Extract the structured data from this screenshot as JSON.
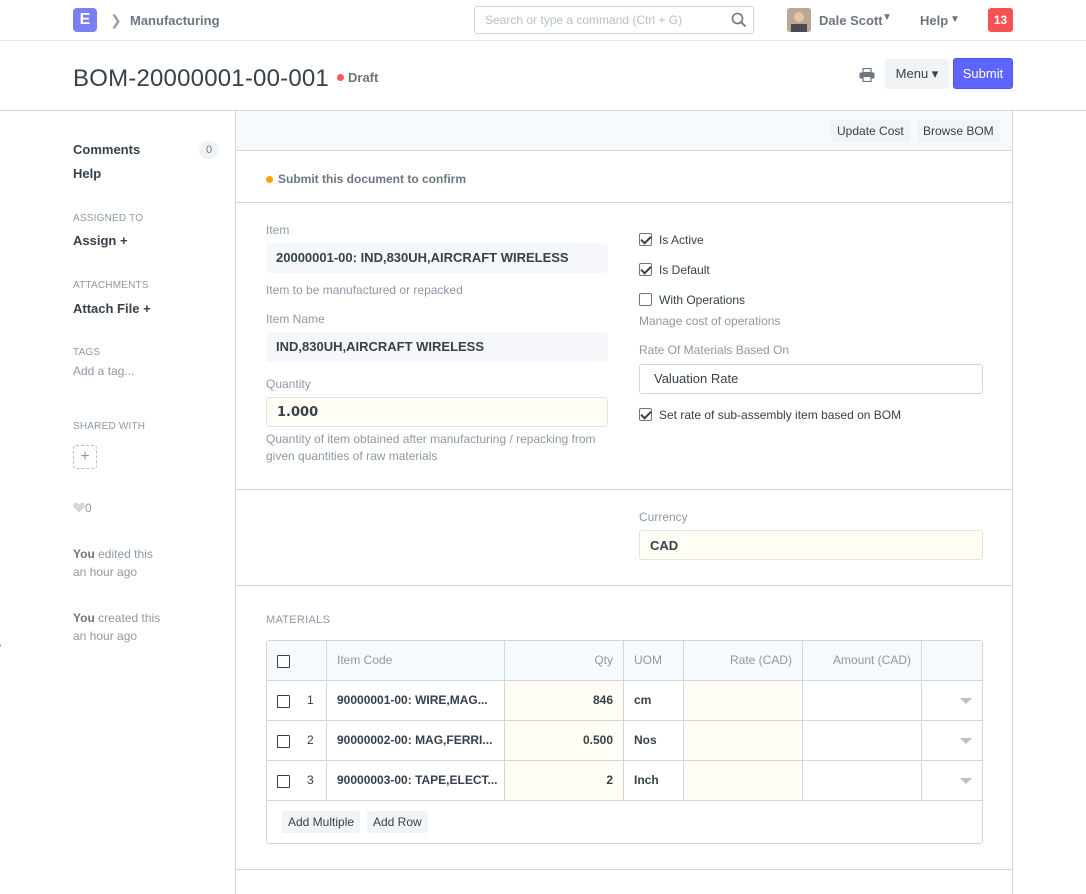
{
  "navbar": {
    "logo_letter": "E",
    "breadcrumb": "Manufacturing",
    "search_placeholder": "Search or type a command (Ctrl + G)",
    "user_name": "Dale Scott",
    "help_label": "Help",
    "notification_count": "13"
  },
  "header": {
    "title": "BOM-20000001-00-001",
    "status": "Draft",
    "menu_label": "Menu",
    "submit_label": "Submit"
  },
  "sidebar": {
    "comments_label": "Comments",
    "comments_count": "0",
    "help_label": "Help",
    "assigned_to_label": "Assigned To",
    "assign_label": "Assign",
    "attachments_label": "Attachments",
    "attach_file_label": "Attach File",
    "tags_label": "Tags",
    "add_tag_label": "Add a tag...",
    "shared_with_label": "Shared With",
    "likes": "0",
    "activity": [
      {
        "actor": "You",
        "action": "edited this",
        "time": "an hour ago"
      },
      {
        "actor": "You",
        "action": "created this",
        "time": "an hour ago"
      }
    ]
  },
  "toolbar": {
    "update_cost": "Update Cost",
    "browse_bom": "Browse BOM"
  },
  "form": {
    "confirm_message": "Submit this document to confirm",
    "item_label": "Item",
    "item_value": "20000001-00: IND,830UH,AIRCRAFT WIRELESS",
    "item_help": "Item to be manufactured or repacked",
    "item_name_label": "Item Name",
    "item_name_value": "IND,830UH,AIRCRAFT WIRELESS",
    "quantity_label": "Quantity",
    "quantity_value": "1.000",
    "quantity_help_1": "Quantity of item obtained after manufacturing / repacking from",
    "quantity_help_2": "given quantities of raw materials",
    "is_active_label": "Is Active",
    "is_default_label": "Is Default",
    "with_operations_label": "With Operations",
    "operations_help": "Manage cost of operations",
    "rate_based_on_label": "Rate Of Materials Based On",
    "rate_based_on_value": "Valuation Rate",
    "set_rate_label": "Set rate of sub-assembly item based on BOM",
    "currency_label": "Currency",
    "currency_value": "CAD"
  },
  "materials": {
    "section_label": "Materials",
    "columns": {
      "item_code": "Item Code",
      "qty": "Qty",
      "uom": "UOM",
      "rate": "Rate (CAD)",
      "amount": "Amount (CAD)"
    },
    "rows": [
      {
        "idx": "1",
        "item_code": "90000001-00: WIRE,MAG...",
        "qty": "846",
        "uom": "cm"
      },
      {
        "idx": "2",
        "item_code": "90000002-00: MAG,FERRI...",
        "qty": "0.500",
        "uom": "Nos"
      },
      {
        "idx": "3",
        "item_code": "90000003-00: TAPE,ELECT...",
        "qty": "2",
        "uom": "Inch"
      }
    ],
    "add_multiple": "Add Multiple",
    "add_row": "Add Row"
  }
}
